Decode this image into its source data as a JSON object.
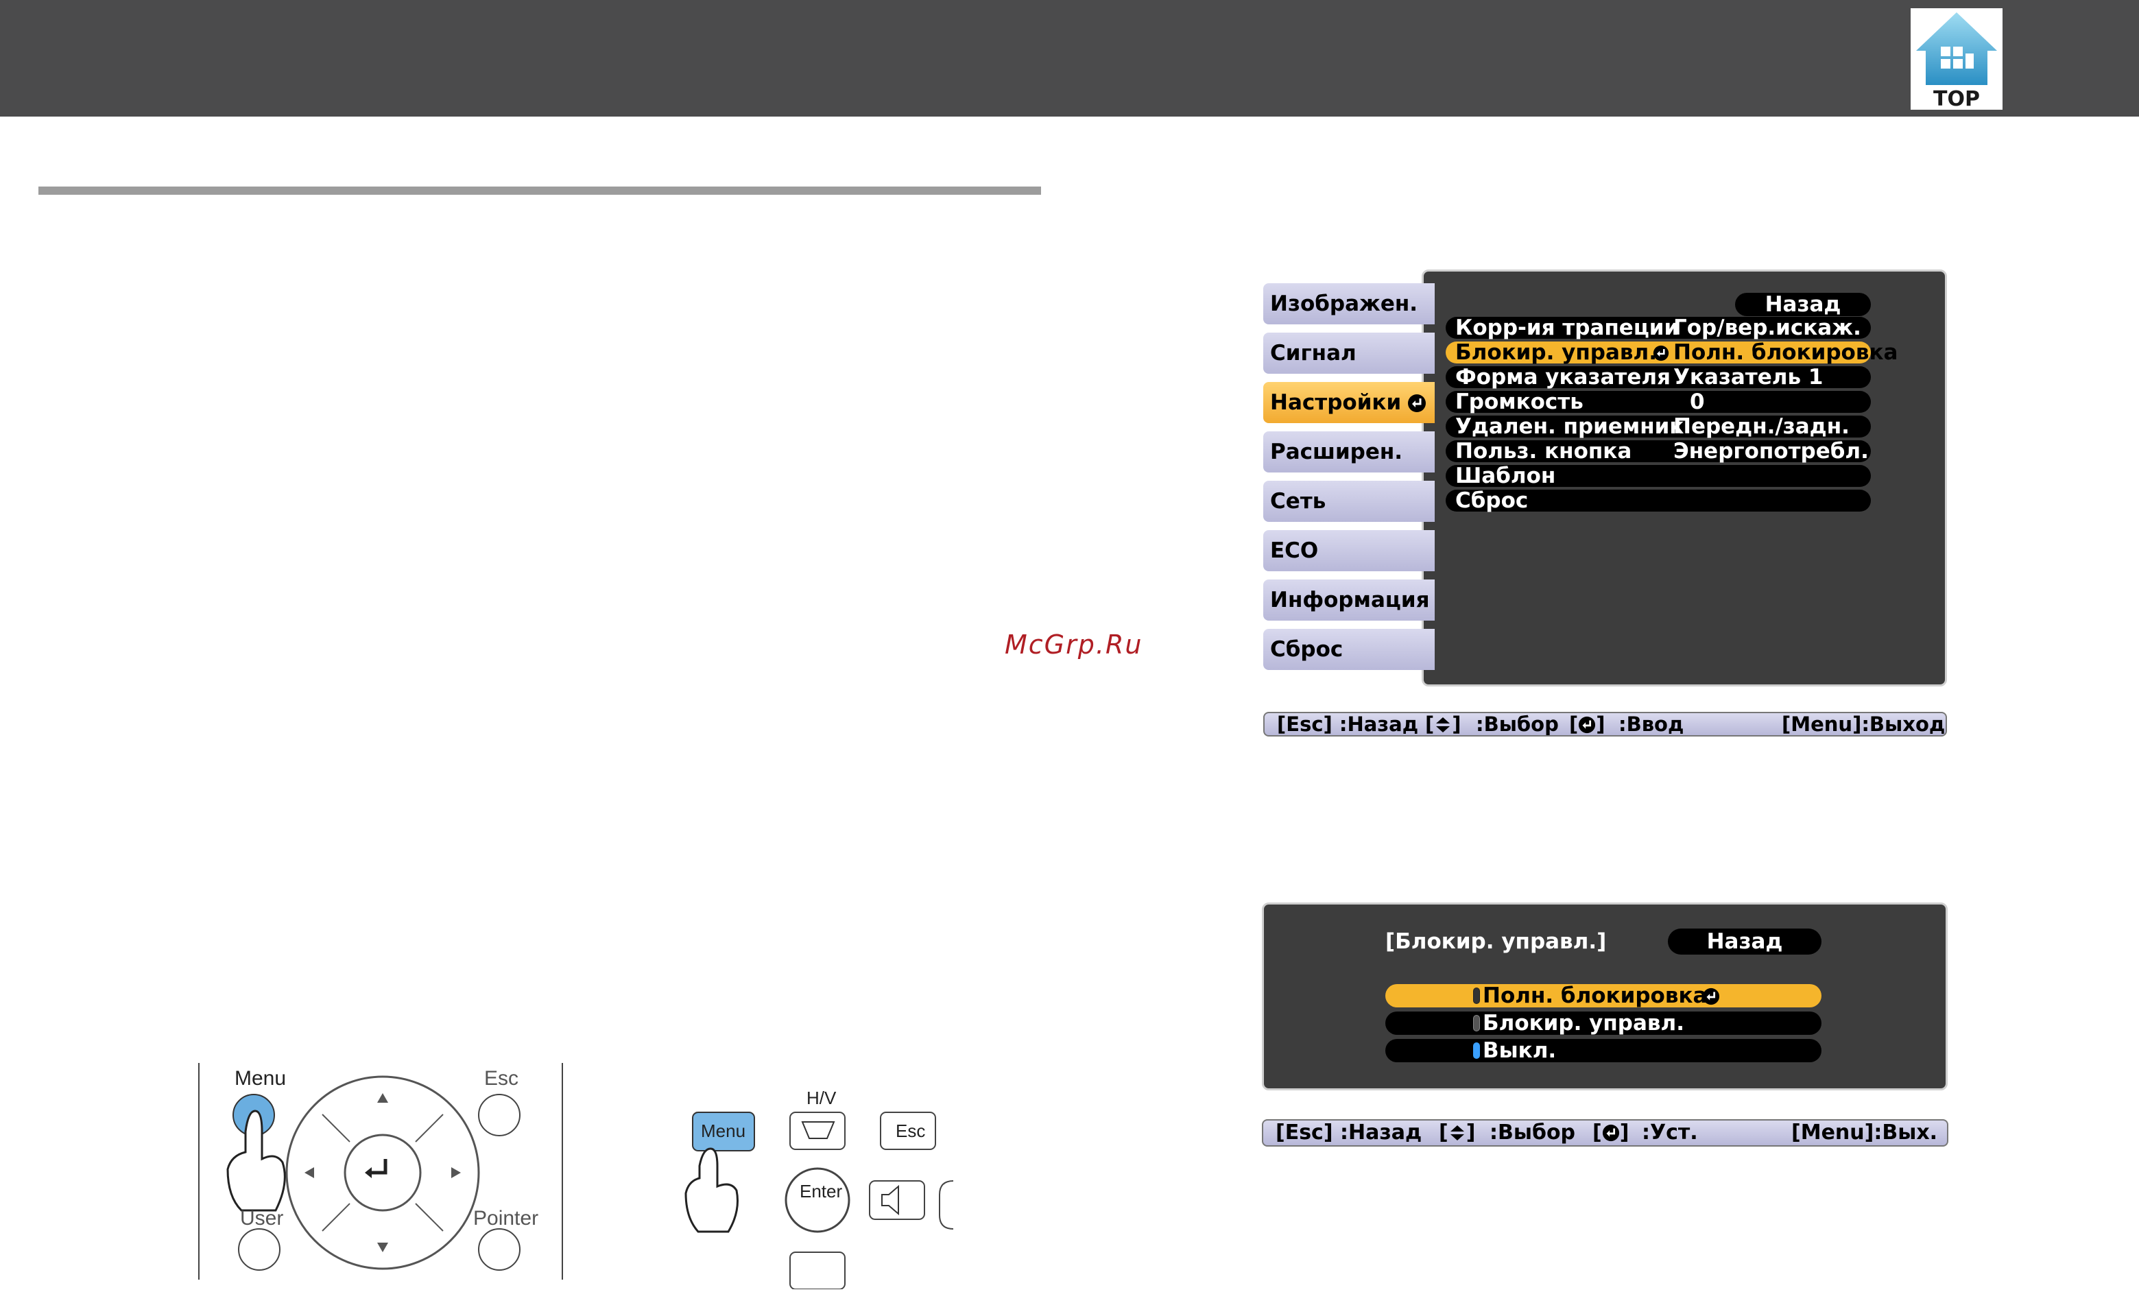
{
  "header": {
    "top_label": "TOP"
  },
  "watermark": "McGrp.Ru",
  "menu": {
    "tabs": [
      {
        "label": "Изображен."
      },
      {
        "label": "Сигнал"
      },
      {
        "label": "Настройки"
      },
      {
        "label": "Расширен."
      },
      {
        "label": "Сеть"
      },
      {
        "label": "ECO"
      },
      {
        "label": "Информация"
      },
      {
        "label": "Сброс"
      }
    ],
    "back_label": "Назад",
    "rows": [
      {
        "label": "Корр-ия трапеции",
        "value": "Гор/вер.искаж."
      },
      {
        "label": "Блокир. управл.",
        "value": "Полн. блокировка"
      },
      {
        "label": "Форма указателя",
        "value": "Указатель 1"
      },
      {
        "label": "Громкость",
        "value": "0"
      },
      {
        "label": "Удален. приемник",
        "value": "Передн./задн."
      },
      {
        "label": "Польз. кнопка",
        "value": "Энергопотребл."
      },
      {
        "label": "Шаблон",
        "value": ""
      },
      {
        "label": "Сброс",
        "value": ""
      }
    ],
    "hint": {
      "esc": "[Esc] :Назад",
      "select": ":Выбор",
      "enter": ":Ввод",
      "menu": "[Menu]:Выход"
    }
  },
  "submenu": {
    "title": "[Блокир. управл.]",
    "back_label": "Назад",
    "options": [
      {
        "label": "Полн. блокировка"
      },
      {
        "label": "Блокир. управл."
      },
      {
        "label": "Выкл."
      }
    ],
    "hint": {
      "esc": "[Esc] :Назад",
      "select": ":Выбор",
      "set": ":Уст.",
      "menu": "[Menu]:Вых."
    }
  },
  "remote": {
    "menu": "Menu",
    "esc": "Esc",
    "user": "User",
    "pointer": "Pointer"
  },
  "panel_buttons": {
    "hv": "H/V",
    "menu": "Menu",
    "esc": "Esc",
    "enter": "Enter"
  }
}
